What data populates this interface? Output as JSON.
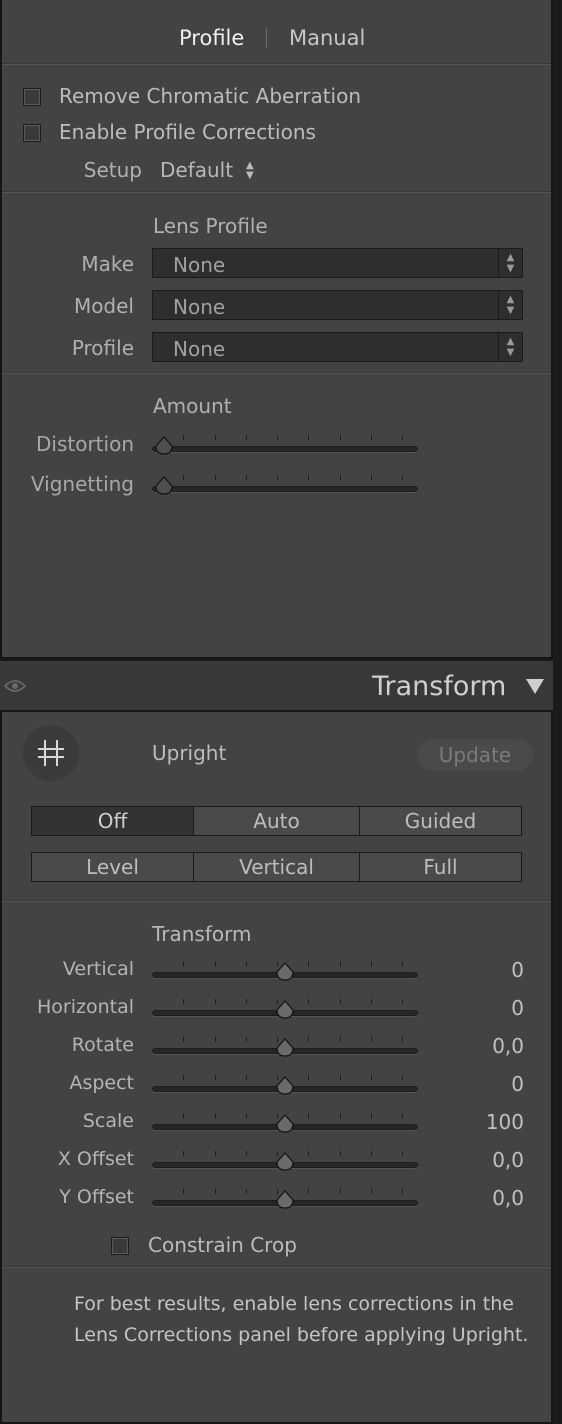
{
  "lens_corrections": {
    "tabs": [
      {
        "label": "Profile",
        "active": true
      },
      {
        "label": "Manual",
        "active": false
      }
    ],
    "remove_ca_label": "Remove Chromatic Aberration",
    "enable_profile_label": "Enable Profile Corrections",
    "setup_label": "Setup",
    "setup_value": "Default",
    "lens_profile_heading": "Lens Profile",
    "make_label": "Make",
    "make_value": "None",
    "model_label": "Model",
    "model_value": "None",
    "profile_label": "Profile",
    "profile_value": "None",
    "amount_heading": "Amount",
    "distortion_label": "Distortion",
    "vignetting_label": "Vignetting"
  },
  "transform": {
    "title": "Transform",
    "upright_label": "Upright",
    "update_label": "Update",
    "modes": [
      "Off",
      "Auto",
      "Guided",
      "Level",
      "Vertical",
      "Full"
    ],
    "selected_mode": "Off",
    "section_heading": "Transform",
    "sliders": [
      {
        "label": "Vertical",
        "value": "0"
      },
      {
        "label": "Horizontal",
        "value": "0"
      },
      {
        "label": "Rotate",
        "value": "0,0"
      },
      {
        "label": "Aspect",
        "value": "0"
      },
      {
        "label": "Scale",
        "value": "100"
      },
      {
        "label": "X Offset",
        "value": "0,0"
      },
      {
        "label": "Y Offset",
        "value": "0,0"
      }
    ],
    "constrain_crop_label": "Constrain Crop",
    "note_line1": "For best results, enable lens corrections in the",
    "note_line2": "Lens Corrections panel before applying Upright."
  },
  "icons": {
    "visibility": "eye-icon",
    "collapse": "triangle-down-icon",
    "upright_tool": "crop-guides-icon"
  }
}
